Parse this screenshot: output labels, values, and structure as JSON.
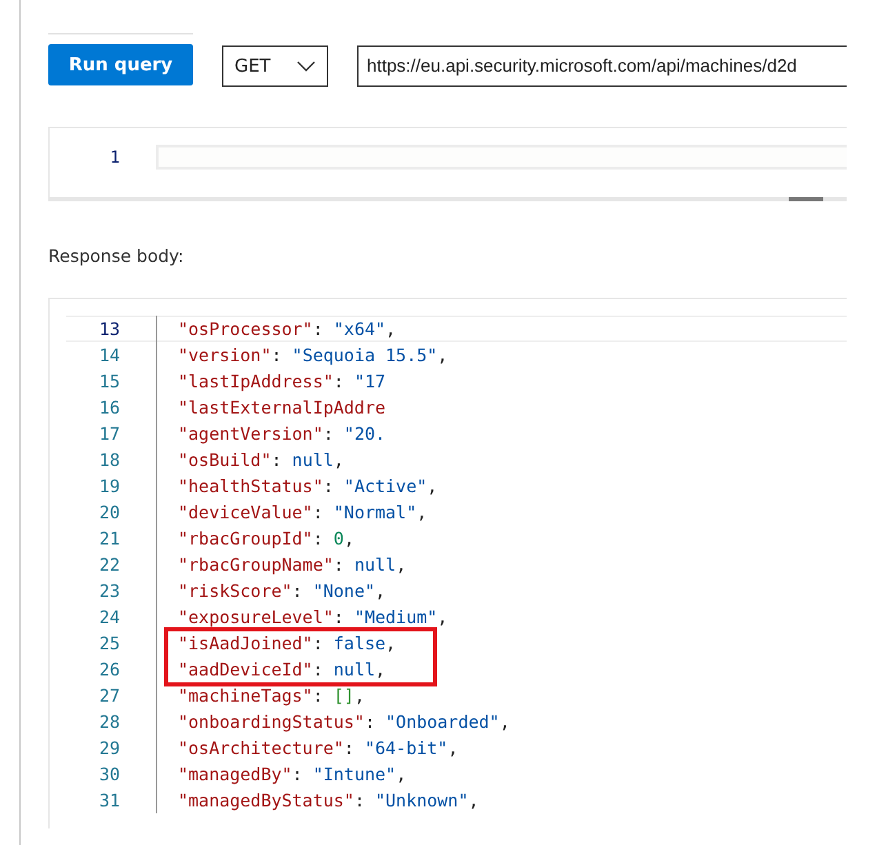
{
  "toolbar": {
    "run_button": "Run query",
    "method": {
      "value": "GET"
    },
    "url": {
      "value": "https://eu.api.security.microsoft.com/api/machines/d2d"
    }
  },
  "request_editor": {
    "lines": [
      {
        "number": "1"
      }
    ]
  },
  "response": {
    "label": "Response body:",
    "lines": [
      {
        "number": "13",
        "current": true,
        "highlighted": false,
        "tokens": [
          {
            "kind": "key",
            "text": "\"osProcessor\""
          },
          {
            "kind": "punct",
            "text": ": "
          },
          {
            "kind": "string",
            "text": "\"x64\""
          },
          {
            "kind": "punct",
            "text": ","
          }
        ]
      },
      {
        "number": "14",
        "current": false,
        "highlighted": false,
        "tokens": [
          {
            "kind": "key",
            "text": "\"version\""
          },
          {
            "kind": "punct",
            "text": ": "
          },
          {
            "kind": "string",
            "text": "\"Sequoia 15.5\""
          },
          {
            "kind": "punct",
            "text": ","
          }
        ]
      },
      {
        "number": "15",
        "current": false,
        "highlighted": false,
        "tokens": [
          {
            "kind": "key",
            "text": "\"lastIpAddress\""
          },
          {
            "kind": "punct",
            "text": ": "
          },
          {
            "kind": "string",
            "text": "\"17"
          }
        ]
      },
      {
        "number": "16",
        "current": false,
        "highlighted": false,
        "tokens": [
          {
            "kind": "key",
            "text": "\"lastExternalIpAddre"
          }
        ]
      },
      {
        "number": "17",
        "current": false,
        "highlighted": false,
        "tokens": [
          {
            "kind": "key",
            "text": "\"agentVersion\""
          },
          {
            "kind": "punct",
            "text": ": "
          },
          {
            "kind": "string",
            "text": "\"20."
          }
        ]
      },
      {
        "number": "18",
        "current": false,
        "highlighted": false,
        "tokens": [
          {
            "kind": "key",
            "text": "\"osBuild\""
          },
          {
            "kind": "punct",
            "text": ": "
          },
          {
            "kind": "literal",
            "text": "null"
          },
          {
            "kind": "punct",
            "text": ","
          }
        ]
      },
      {
        "number": "19",
        "current": false,
        "highlighted": false,
        "tokens": [
          {
            "kind": "key",
            "text": "\"healthStatus\""
          },
          {
            "kind": "punct",
            "text": ": "
          },
          {
            "kind": "string",
            "text": "\"Active\""
          },
          {
            "kind": "punct",
            "text": ","
          }
        ]
      },
      {
        "number": "20",
        "current": false,
        "highlighted": false,
        "tokens": [
          {
            "kind": "key",
            "text": "\"deviceValue\""
          },
          {
            "kind": "punct",
            "text": ": "
          },
          {
            "kind": "string",
            "text": "\"Normal\""
          },
          {
            "kind": "punct",
            "text": ","
          }
        ]
      },
      {
        "number": "21",
        "current": false,
        "highlighted": false,
        "tokens": [
          {
            "kind": "key",
            "text": "\"rbacGroupId\""
          },
          {
            "kind": "punct",
            "text": ": "
          },
          {
            "kind": "number",
            "text": "0"
          },
          {
            "kind": "punct",
            "text": ","
          }
        ]
      },
      {
        "number": "22",
        "current": false,
        "highlighted": false,
        "tokens": [
          {
            "kind": "key",
            "text": "\"rbacGroupName\""
          },
          {
            "kind": "punct",
            "text": ": "
          },
          {
            "kind": "literal",
            "text": "null"
          },
          {
            "kind": "punct",
            "text": ","
          }
        ]
      },
      {
        "number": "23",
        "current": false,
        "highlighted": false,
        "tokens": [
          {
            "kind": "key",
            "text": "\"riskScore\""
          },
          {
            "kind": "punct",
            "text": ": "
          },
          {
            "kind": "string",
            "text": "\"None\""
          },
          {
            "kind": "punct",
            "text": ","
          }
        ]
      },
      {
        "number": "24",
        "current": false,
        "highlighted": false,
        "tokens": [
          {
            "kind": "key",
            "text": "\"exposureLevel\""
          },
          {
            "kind": "punct",
            "text": ": "
          },
          {
            "kind": "string",
            "text": "\"Medium\""
          },
          {
            "kind": "punct",
            "text": ","
          }
        ]
      },
      {
        "number": "25",
        "current": false,
        "highlighted": true,
        "tokens": [
          {
            "kind": "key",
            "text": "\"isAadJoined\""
          },
          {
            "kind": "punct",
            "text": ": "
          },
          {
            "kind": "literal",
            "text": "false"
          },
          {
            "kind": "punct",
            "text": ","
          }
        ]
      },
      {
        "number": "26",
        "current": false,
        "highlighted": true,
        "tokens": [
          {
            "kind": "key",
            "text": "\"aadDeviceId\""
          },
          {
            "kind": "punct",
            "text": ": "
          },
          {
            "kind": "literal",
            "text": "null"
          },
          {
            "kind": "punct",
            "text": ","
          }
        ]
      },
      {
        "number": "27",
        "current": false,
        "highlighted": false,
        "tokens": [
          {
            "kind": "key",
            "text": "\"machineTags\""
          },
          {
            "kind": "punct",
            "text": ": "
          },
          {
            "kind": "bracket",
            "text": "[]"
          },
          {
            "kind": "punct",
            "text": ","
          }
        ]
      },
      {
        "number": "28",
        "current": false,
        "highlighted": false,
        "tokens": [
          {
            "kind": "key",
            "text": "\"onboardingStatus\""
          },
          {
            "kind": "punct",
            "text": ": "
          },
          {
            "kind": "string",
            "text": "\"Onboarded\""
          },
          {
            "kind": "punct",
            "text": ","
          }
        ]
      },
      {
        "number": "29",
        "current": false,
        "highlighted": false,
        "tokens": [
          {
            "kind": "key",
            "text": "\"osArchitecture\""
          },
          {
            "kind": "punct",
            "text": ": "
          },
          {
            "kind": "string",
            "text": "\"64-bit\""
          },
          {
            "kind": "punct",
            "text": ","
          }
        ]
      },
      {
        "number": "30",
        "current": false,
        "highlighted": false,
        "tokens": [
          {
            "kind": "key",
            "text": "\"managedBy\""
          },
          {
            "kind": "punct",
            "text": ": "
          },
          {
            "kind": "string",
            "text": "\"Intune\""
          },
          {
            "kind": "punct",
            "text": ","
          }
        ]
      },
      {
        "number": "31",
        "current": false,
        "highlighted": false,
        "tokens": [
          {
            "kind": "key",
            "text": "\"managedByStatus\""
          },
          {
            "kind": "punct",
            "text": ": "
          },
          {
            "kind": "string",
            "text": "\"Unknown\""
          },
          {
            "kind": "punct",
            "text": ","
          }
        ]
      }
    ]
  }
}
